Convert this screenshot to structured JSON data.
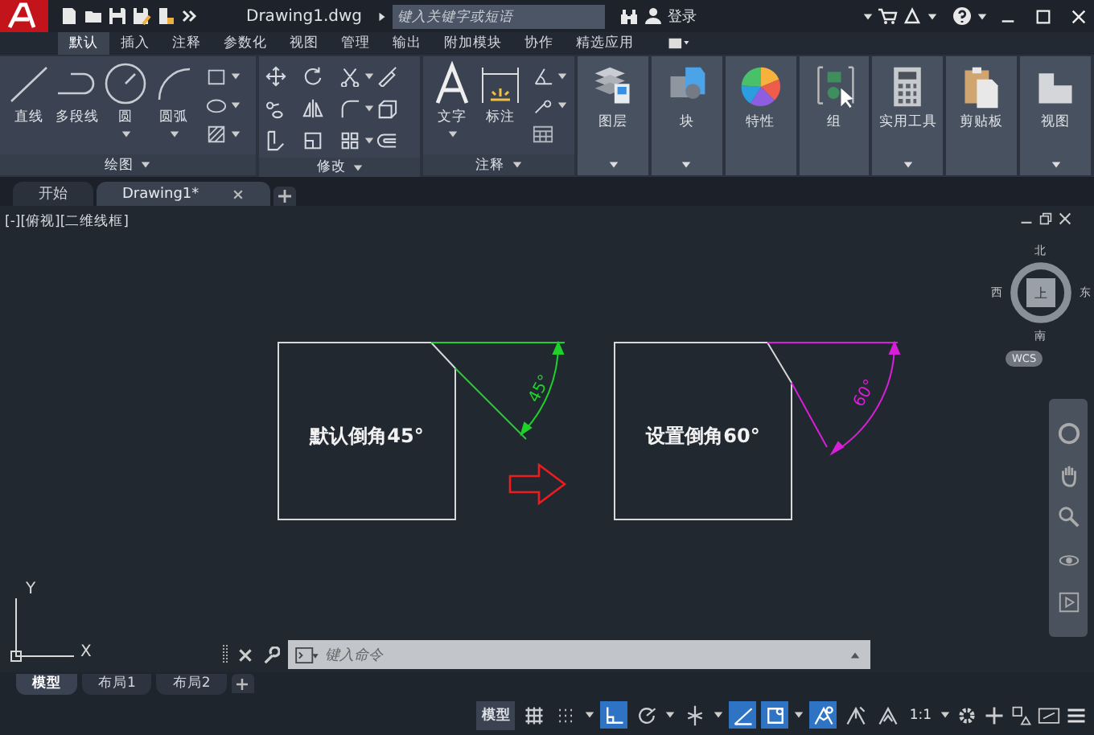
{
  "title_bar": {
    "file_name": "Drawing1.dwg",
    "search": {
      "placeholder": "键入关键字或短语"
    },
    "sign_in": "登录"
  },
  "ribbon": {
    "tabs": [
      {
        "label": "默认",
        "selected": true
      },
      {
        "label": "插入",
        "selected": false
      },
      {
        "label": "注释",
        "selected": false
      },
      {
        "label": "参数化",
        "selected": false
      },
      {
        "label": "视图",
        "selected": false
      },
      {
        "label": "管理",
        "selected": false
      },
      {
        "label": "输出",
        "selected": false
      },
      {
        "label": "附加模块",
        "selected": false
      },
      {
        "label": "协作",
        "selected": false
      },
      {
        "label": "精选应用",
        "selected": false
      }
    ],
    "draw_panel": {
      "title": "绘图",
      "tools": [
        {
          "label": "直线",
          "dropdown": false
        },
        {
          "label": "多段线",
          "dropdown": false
        },
        {
          "label": "圆",
          "dropdown": true
        },
        {
          "label": "圆弧",
          "dropdown": true
        }
      ]
    },
    "modify_panel": {
      "title": "修改"
    },
    "annotation_panel": {
      "title": "注释",
      "tools": [
        {
          "label": "文字",
          "dropdown": true
        },
        {
          "label": "标注",
          "dropdown": false
        }
      ]
    },
    "big_buttons": [
      {
        "kind": "layers",
        "label": "图层",
        "dropdown": true
      },
      {
        "kind": "block",
        "label": "块",
        "dropdown": true
      },
      {
        "kind": "properties",
        "label": "特性",
        "dropdown": false
      },
      {
        "kind": "group",
        "label": "组",
        "dropdown": false
      },
      {
        "kind": "utilities",
        "label": "实用工具",
        "dropdown": true
      },
      {
        "kind": "clipboard",
        "label": "剪贴板",
        "dropdown": false
      },
      {
        "kind": "view",
        "label": "视图",
        "dropdown": true
      }
    ]
  },
  "file_tabs": [
    {
      "label": "开始",
      "selected": false,
      "closable": false
    },
    {
      "label": "Drawing1*",
      "selected": true,
      "closable": true
    }
  ],
  "viewport": {
    "label": "[-][俯视][二维线框]",
    "view_cube": {
      "north": "北",
      "west": "西",
      "east": "东",
      "south": "南",
      "face": "上",
      "ucs": "WCS"
    },
    "drawing": {
      "left_caption": "默认倒角45°",
      "left_angle": "45°",
      "right_caption": "设置倒角60°",
      "right_angle": "60°",
      "ucs_x": "X",
      "ucs_y": "Y"
    }
  },
  "command_line": {
    "placeholder": "键入命令"
  },
  "layout_tabs": [
    {
      "label": "模型",
      "selected": true
    },
    {
      "label": "布局1",
      "selected": false
    },
    {
      "label": "布局2",
      "selected": false
    }
  ],
  "status_bar": {
    "space": "模型",
    "toggles": [
      {
        "kind": "grid",
        "on": false,
        "dropdown": false
      },
      {
        "kind": "snap",
        "on": false,
        "dropdown": true
      },
      {
        "kind": "ortho",
        "on": true,
        "dropdown": false
      },
      {
        "kind": "polar",
        "on": false,
        "dropdown": true
      },
      {
        "kind": "isodraft",
        "on": false,
        "dropdown": true
      },
      {
        "kind": "tracking",
        "on": true,
        "dropdown": false
      },
      {
        "kind": "osnap",
        "on": true,
        "dropdown": true
      },
      {
        "kind": "annotation",
        "on": true,
        "dropdown": false
      },
      {
        "kind": "autoscale",
        "on": false,
        "dropdown": false
      },
      {
        "kind": "annoscale",
        "on": false,
        "dropdown": false
      }
    ],
    "scale": "1:1"
  }
}
